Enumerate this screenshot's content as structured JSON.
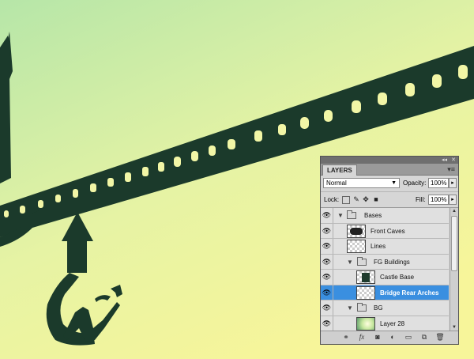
{
  "artwork": {
    "silhouette_color": "#1b3a2b",
    "sky_top": "#bde9a8",
    "sky_bottom": "#f6f6a0"
  },
  "panel": {
    "tab_title": "LAYERS",
    "collapse_glyph": "◂◂",
    "close_glyph": "✕",
    "menu_glyph": "▾≡",
    "blend_mode": "Normal",
    "opacity_label": "Opacity:",
    "opacity_value": "100%",
    "lock_label": "Lock:",
    "fill_label": "Fill:",
    "fill_value": "100%",
    "lock_icons": [
      "lock-transparent-icon",
      "lock-pixels-icon",
      "lock-position-icon",
      "lock-all-icon"
    ]
  },
  "layers": [
    {
      "name": "Bases",
      "kind": "group",
      "depth": 0,
      "expanded": true,
      "visible": true,
      "selected": false
    },
    {
      "name": "Front Caves",
      "kind": "layer",
      "depth": 1,
      "thumb": "dark",
      "visible": true,
      "selected": false
    },
    {
      "name": "Lines",
      "kind": "layer",
      "depth": 1,
      "thumb": "empty",
      "visible": true,
      "selected": false
    },
    {
      "name": "FG Buildings",
      "kind": "group",
      "depth": 1,
      "expanded": true,
      "visible": true,
      "selected": false
    },
    {
      "name": "Castle Base",
      "kind": "layer",
      "depth": 2,
      "thumb": "castle",
      "visible": true,
      "selected": false
    },
    {
      "name": "Bridge Rear Arches",
      "kind": "layer",
      "depth": 2,
      "thumb": "empty",
      "visible": true,
      "selected": true
    },
    {
      "name": "BG",
      "kind": "group",
      "depth": 1,
      "expanded": true,
      "visible": true,
      "selected": false
    },
    {
      "name": "Layer 28",
      "kind": "layer",
      "depth": 2,
      "thumb": "bg",
      "visible": true,
      "selected": false
    }
  ],
  "bottom_icons": [
    "link-layers-icon",
    "fx-icon",
    "layer-mask-icon",
    "adjustment-layer-icon",
    "new-group-icon",
    "new-layer-icon",
    "delete-layer-icon"
  ]
}
